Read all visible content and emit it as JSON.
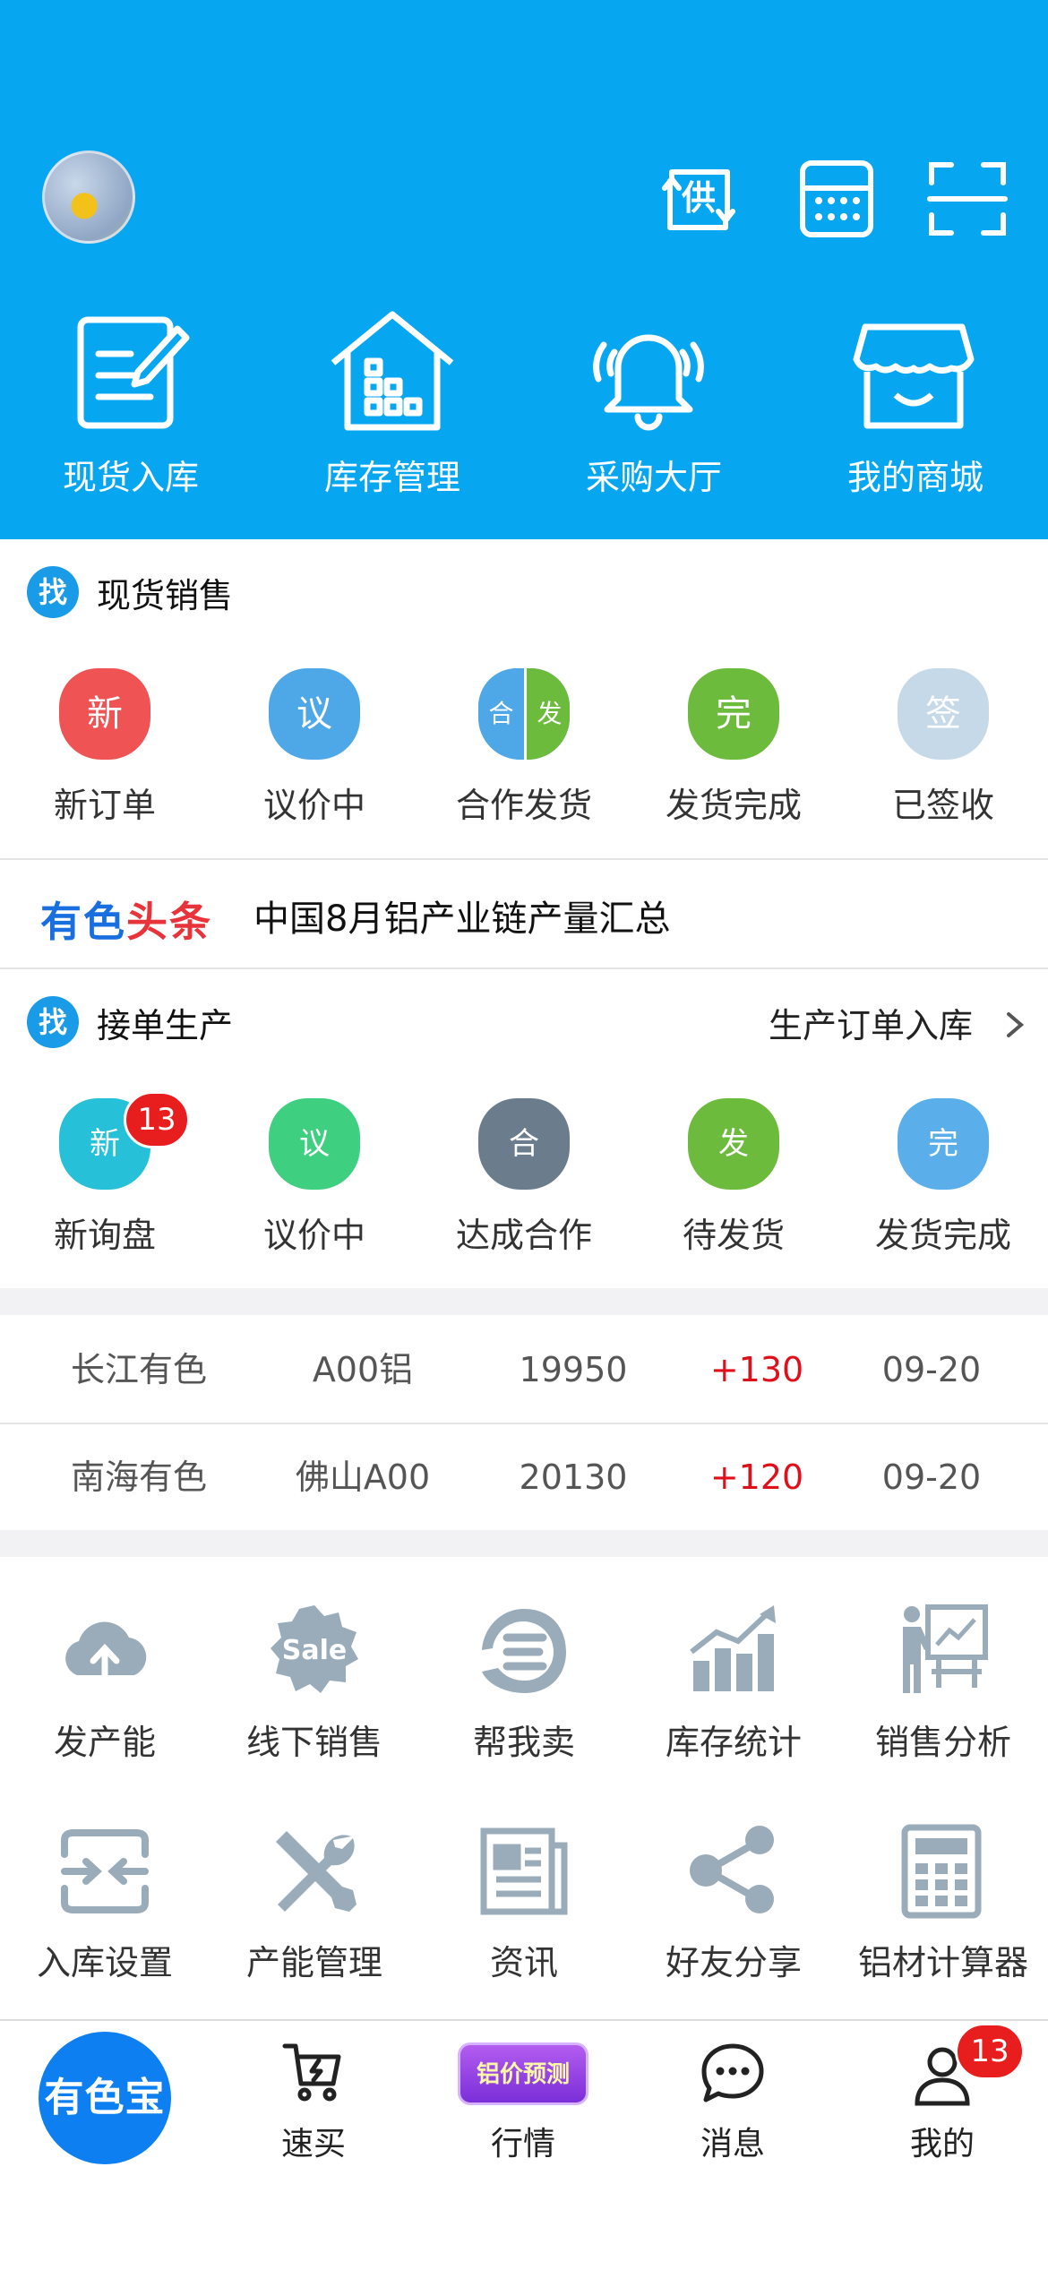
{
  "header": {
    "colors": {
      "bg": "#07a6f1"
    },
    "icons": [
      "supply-icon",
      "calculator-icon",
      "scan-icon"
    ],
    "supply_char": "供",
    "quick_actions": [
      {
        "label": "现货入库",
        "icon": "document-edit-icon"
      },
      {
        "label": "库存管理",
        "icon": "warehouse-icon"
      },
      {
        "label": "采购大厅",
        "icon": "bell-icon"
      },
      {
        "label": "我的商城",
        "icon": "shop-icon"
      }
    ]
  },
  "spot_sales": {
    "badge": "找",
    "title": "现货销售",
    "items": [
      {
        "char": "新",
        "label": "新订单",
        "color": "#ef5353"
      },
      {
        "char": "议",
        "label": "议价中",
        "color": "#4ea8e8"
      },
      {
        "char_left": "合",
        "char_right": "发",
        "label": "合作发货",
        "color_left": "#4ea8e8",
        "color_right": "#6cbb3c"
      },
      {
        "char": "完",
        "label": "发货完成",
        "color": "#6cbb3c"
      },
      {
        "char": "签",
        "label": "已签收",
        "color": "#c5d9e8"
      }
    ]
  },
  "news": {
    "brand_part1": "有色",
    "brand_part2": "头条",
    "headline": "中国8月铝产业链产量汇总",
    "colors": {
      "brand_blue": "#1a6fe0",
      "brand_red": "#e8333a"
    }
  },
  "production": {
    "badge": "找",
    "title": "接单生产",
    "link": "生产订单入库",
    "items": [
      {
        "char": "新",
        "label": "新询盘",
        "color": "#26c1d8",
        "badge": "13"
      },
      {
        "char": "议",
        "label": "议价中",
        "color": "#3fcf80"
      },
      {
        "char": "合",
        "label": "达成合作",
        "color": "#6b7c8c"
      },
      {
        "char": "发",
        "label": "待发货",
        "color": "#6cbb3c"
      },
      {
        "char": "完",
        "label": "发货完成",
        "color": "#5aaeea"
      }
    ]
  },
  "prices": [
    {
      "market": "长江有色",
      "product": "A00铝",
      "price": "19950",
      "change": "+130",
      "date": "09-20"
    },
    {
      "market": "南海有色",
      "product": "佛山A00",
      "price": "20130",
      "change": "+120",
      "date": "09-20"
    }
  ],
  "tools": [
    {
      "label": "发产能",
      "icon": "cloud-upload-icon"
    },
    {
      "label": "线下销售",
      "icon": "sale-badge-icon",
      "icon_text": "Sale"
    },
    {
      "label": "帮我卖",
      "icon": "help-sell-icon"
    },
    {
      "label": "库存统计",
      "icon": "bar-chart-icon"
    },
    {
      "label": "销售分析",
      "icon": "presentation-icon"
    },
    {
      "label": "入库设置",
      "icon": "inbound-settings-icon"
    },
    {
      "label": "产能管理",
      "icon": "tools-icon"
    },
    {
      "label": "资讯",
      "icon": "newspaper-icon"
    },
    {
      "label": "好友分享",
      "icon": "share-icon"
    },
    {
      "label": "铝材计算器",
      "icon": "calculator-icon"
    }
  ],
  "tabbar": {
    "home": "有色宝",
    "price_predict": "铝价预测",
    "tabs": [
      {
        "label": "速买",
        "icon": "cart-icon"
      },
      {
        "label": "行情",
        "icon": "price-predict-icon"
      },
      {
        "label": "消息",
        "icon": "chat-icon"
      },
      {
        "label": "我的",
        "icon": "user-icon",
        "badge": "13"
      }
    ]
  }
}
